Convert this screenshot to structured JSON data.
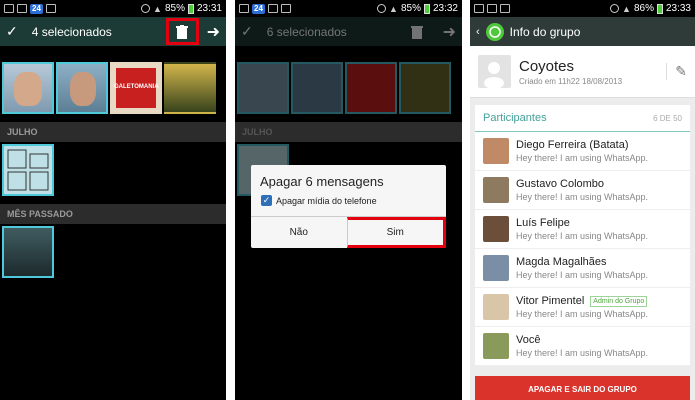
{
  "screen1": {
    "status": {
      "badge": "24",
      "battery_pct": "85%",
      "time": "23:31"
    },
    "action": {
      "title": "4 selecionados"
    },
    "thumb_labels": [
      "GALETOMANIA"
    ],
    "sections": [
      "JULHO",
      "MÊS PASSADO"
    ]
  },
  "screen2": {
    "status": {
      "badge": "24",
      "battery_pct": "85%",
      "time": "23:32"
    },
    "action": {
      "title": "6 selecionados"
    },
    "sections": [
      "JULHO"
    ],
    "dialog": {
      "title": "Apagar 6 mensagens",
      "checkbox_label": "Apagar mídia do telefone",
      "btn_no": "Não",
      "btn_yes": "Sim"
    }
  },
  "screen3": {
    "status": {
      "battery_pct": "86%",
      "time": "23:33"
    },
    "title": "Info do grupo",
    "group": {
      "name": "Coyotes",
      "created": "Criado em 11h22 18/08/2013"
    },
    "participants": {
      "label": "Participantes",
      "count": "6 DE 50",
      "items": [
        {
          "name": "Diego Ferreira (Batata)",
          "status": "Hey there! I am using WhatsApp.",
          "color": "#c08a67"
        },
        {
          "name": "Gustavo Colombo",
          "status": "Hey there! I am using WhatsApp.",
          "color": "#8e7a5e"
        },
        {
          "name": "Luís Felipe",
          "status": "Hey there! I am using WhatsApp.",
          "color": "#6b4f3a"
        },
        {
          "name": "Magda Magalhães",
          "status": "Hey there! I am using WhatsApp.",
          "color": "#7a8fa5"
        },
        {
          "name": "Vitor Pimentel",
          "status": "Hey there! I am using WhatsApp.",
          "color": "#d9c5a8",
          "admin": "Admin do Grupo"
        },
        {
          "name": "Você",
          "status": "Hey there! I am using WhatsApp.",
          "color": "#8a9a5a"
        }
      ]
    },
    "exit_button": "APAGAR E SAIR DO GRUPO"
  }
}
